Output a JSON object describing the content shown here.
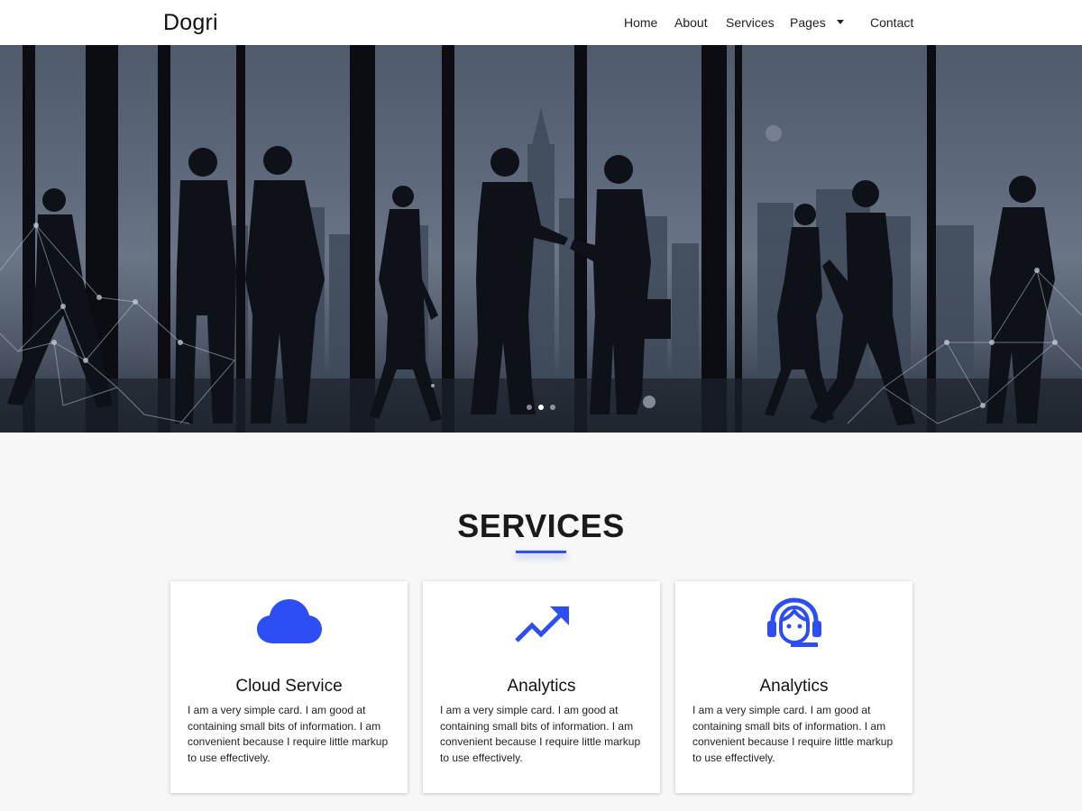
{
  "navbar": {
    "brand": "Dogri",
    "links": [
      "Home",
      "About",
      "Services",
      "Pages",
      "Contact"
    ]
  },
  "hero": {
    "slides_total": 3,
    "active_slide": 2
  },
  "services": {
    "title": "SERVICES",
    "accent_color": "#3050f0",
    "cards": [
      {
        "icon": "cloud-icon",
        "title": "Cloud Service",
        "text": "I am a very simple card. I am good at containing small bits of information. I am convenient because I require little markup to use effectively."
      },
      {
        "icon": "trending-up-icon",
        "title": "Analytics",
        "text": "I am a very simple card. I am good at containing small bits of information. I am convenient because I require little markup to use effectively."
      },
      {
        "icon": "support-agent-icon",
        "title": "Analytics",
        "text": "I am a very simple card. I am good at containing small bits of information. I am convenient because I require little markup to use effectively."
      }
    ]
  }
}
